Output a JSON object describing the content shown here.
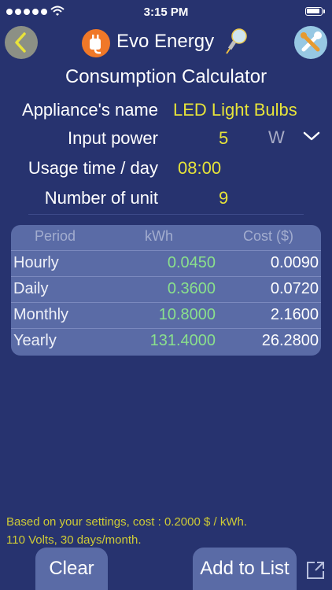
{
  "status_bar": {
    "time": "3:15 PM"
  },
  "header": {
    "app_name": "Evo Energy"
  },
  "page": {
    "title": "Consumption Calculator"
  },
  "form": {
    "appliance_label": "Appliance's name",
    "appliance_value": "LED Light Bulbs",
    "power_label": "Input power",
    "power_value": "5",
    "power_unit": "W",
    "usage_label": "Usage time / day",
    "usage_value": "08:00",
    "units_label": "Number of unit",
    "units_value": "9"
  },
  "table": {
    "headers": {
      "period": "Period",
      "kwh": "kWh",
      "cost": "Cost ($)"
    },
    "rows": [
      {
        "period": "Hourly",
        "kwh": "0.0450",
        "cost": "0.0090"
      },
      {
        "period": "Daily",
        "kwh": "0.3600",
        "cost": "0.0720"
      },
      {
        "period": "Monthly",
        "kwh": "10.8000",
        "cost": "2.1600"
      },
      {
        "period": "Yearly",
        "kwh": "131.4000",
        "cost": "26.2800"
      }
    ]
  },
  "footer": {
    "note_line1": "Based on your settings, cost : 0.2000 $ / kWh.",
    "note_line2": "110 Volts, 30 days/month.",
    "clear_label": "Clear",
    "add_label": "Add to List"
  },
  "colors": {
    "background": "#27336f",
    "value_yellow": "#e6e33a",
    "kwh_green": "#8ae08c",
    "table_bg": "#5a6ba6",
    "logo_orange": "#f07828"
  },
  "icons": [
    "signal-dots-icon",
    "wifi-icon",
    "battery-icon",
    "back-chevron-icon",
    "plug-icon",
    "lightbulb-icon",
    "tools-icon",
    "chevron-down-icon",
    "export-icon"
  ]
}
